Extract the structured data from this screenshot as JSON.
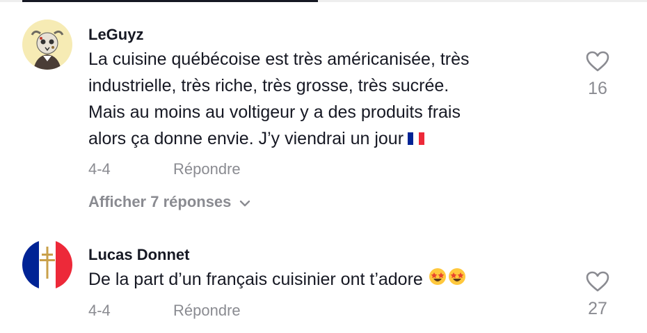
{
  "comments": [
    {
      "username": "LeGuyz",
      "lines": [
        "La cuisine québécoise est très américanisée, très",
        "industrielle, très riche, très grosse, très sucrée.",
        "Mais au moins au voltigeur y a des produits frais",
        "alors ça donne envie. J’y viendrai un jour"
      ],
      "emoji": "🇫🇷",
      "date": "4-4",
      "reply_label": "Répondre",
      "likes": "16",
      "view_replies": "Afficher 7 réponses"
    },
    {
      "username": "Lucas Donnet",
      "lines": [
        "De la part d’un français cuisinier ont t’adore"
      ],
      "emoji": "🤩🤩",
      "date": "4-4",
      "reply_label": "Répondre",
      "likes": "27"
    }
  ],
  "icons": {
    "like": "heart-outline-icon",
    "expand": "chevron-down-icon",
    "avatar1": "skull-cow-avatar",
    "avatar2": "cross-of-lorraine-flag-avatar"
  },
  "colors": {
    "text": "#161823",
    "secondary": "#8a8b91",
    "flag_blue": "#002395",
    "flag_red": "#ED2939"
  }
}
